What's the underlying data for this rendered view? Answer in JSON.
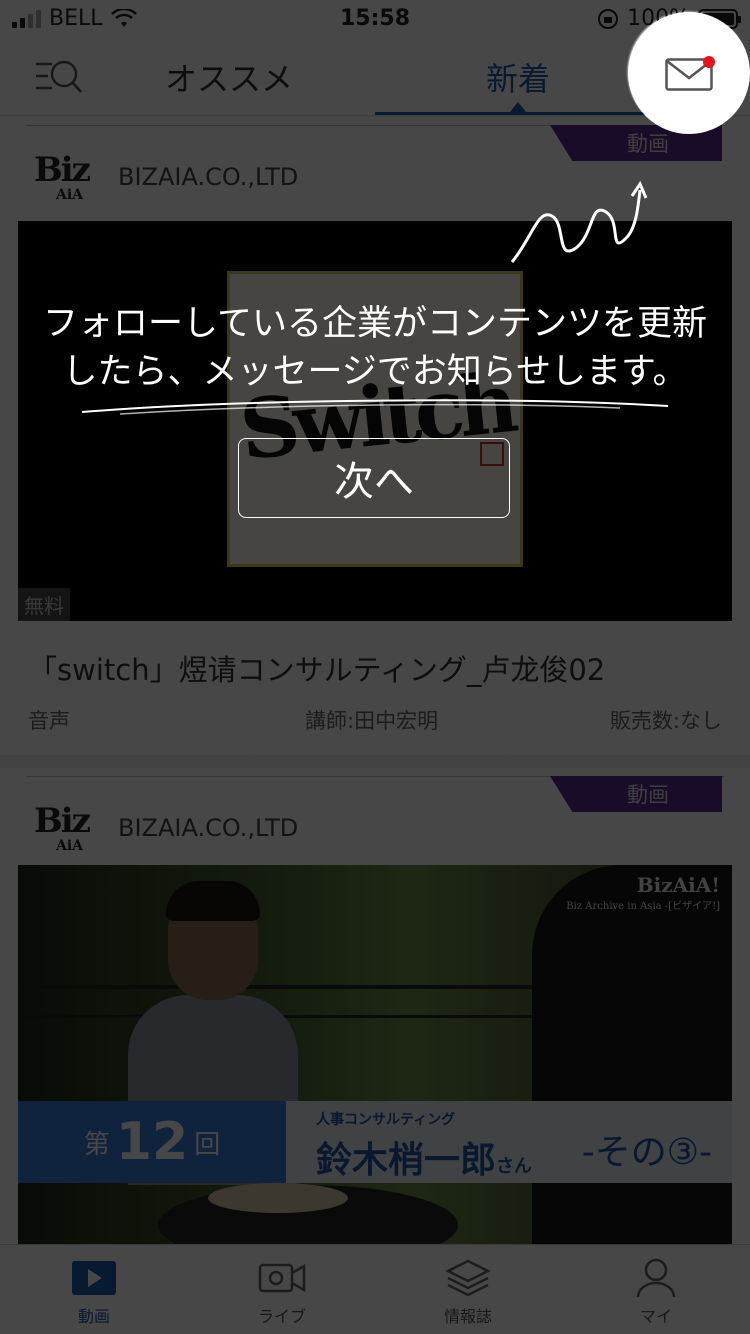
{
  "status_bar": {
    "carrier": "BELL",
    "time": "15:58",
    "battery": "100%"
  },
  "header": {
    "tabs": [
      {
        "label": "オススメ"
      },
      {
        "label": "新着"
      }
    ],
    "active_tab": "新着"
  },
  "cards": [
    {
      "badge": "動画",
      "logo_big": "Biz",
      "logo_small": "AiA",
      "company": "BIZAIA.CO.,LTD",
      "thumbnail_text": "Switch",
      "price_tag": "無料",
      "title": "「switch」煜请コンサルティング_卢龙俊02",
      "type": "音声",
      "lecturer": "講師:田中宏明",
      "sales": "販売数:なし"
    },
    {
      "badge": "動画",
      "logo_big": "Biz",
      "logo_small": "AiA",
      "company": "BIZAIA.CO.,LTD",
      "brand": "BizAiA!",
      "brand_sub": "Biz Archive in Asia -[ビザイア!]",
      "episode_pre": "第",
      "episode_num": "12",
      "episode_post": "回",
      "category": "人事コンサルティング",
      "speaker": "鈴木梢一郎",
      "speaker_suffix": "さん",
      "part": "-その③-"
    }
  ],
  "tabbar": [
    {
      "label": "動画"
    },
    {
      "label": "ライブ"
    },
    {
      "label": "情報誌"
    },
    {
      "label": "マイ"
    }
  ],
  "overlay": {
    "tip_line1": "フォローしている企業がコンテンツを更新",
    "tip_line2": "したら、メッセージでお知らせします。",
    "next_label": "次へ"
  },
  "colors": {
    "accent": "#1d5fa8",
    "badge": "#5a2a8e",
    "notify_dot": "#e8121b"
  }
}
